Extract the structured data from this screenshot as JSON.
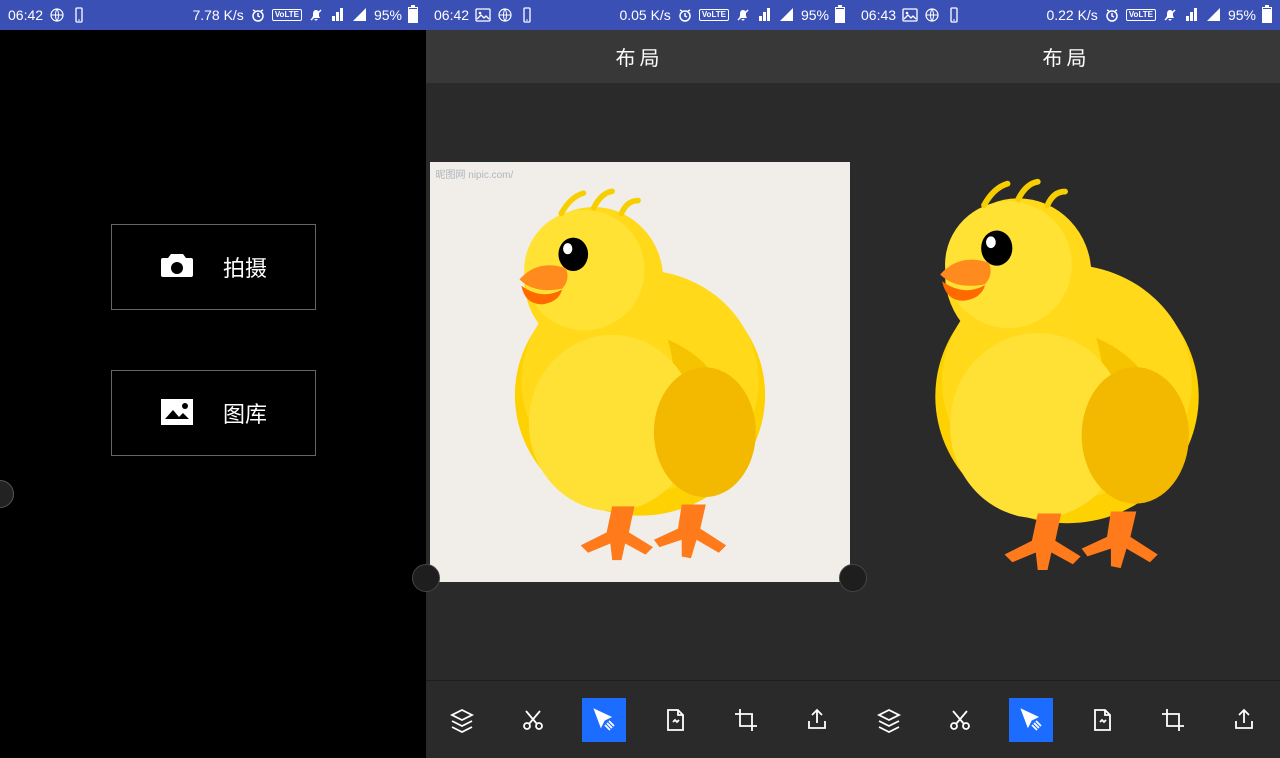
{
  "screens": [
    {
      "status": {
        "time": "06:42",
        "speed": "7.78 K/s",
        "battery": "95%"
      },
      "buttons": {
        "camera": "拍摄",
        "gallery": "图库"
      }
    },
    {
      "status": {
        "time": "06:42",
        "speed": "0.05 K/s",
        "battery": "95%"
      },
      "header": "布局",
      "image": {
        "watermark": "昵图网 nipic.com/",
        "subject": "yellow-chick",
        "background": "white"
      },
      "tools": [
        "layers",
        "cut",
        "select",
        "page",
        "crop",
        "share"
      ],
      "active_tool": "select"
    },
    {
      "status": {
        "time": "06:43",
        "speed": "0.22 K/s",
        "battery": "95%"
      },
      "header": "布局",
      "image": {
        "subject": "yellow-chick",
        "background": "transparent"
      },
      "tools": [
        "layers",
        "cut",
        "select",
        "page",
        "crop",
        "share"
      ],
      "active_tool": "select"
    }
  ],
  "status_labels": {
    "volte": "VoLTE"
  }
}
